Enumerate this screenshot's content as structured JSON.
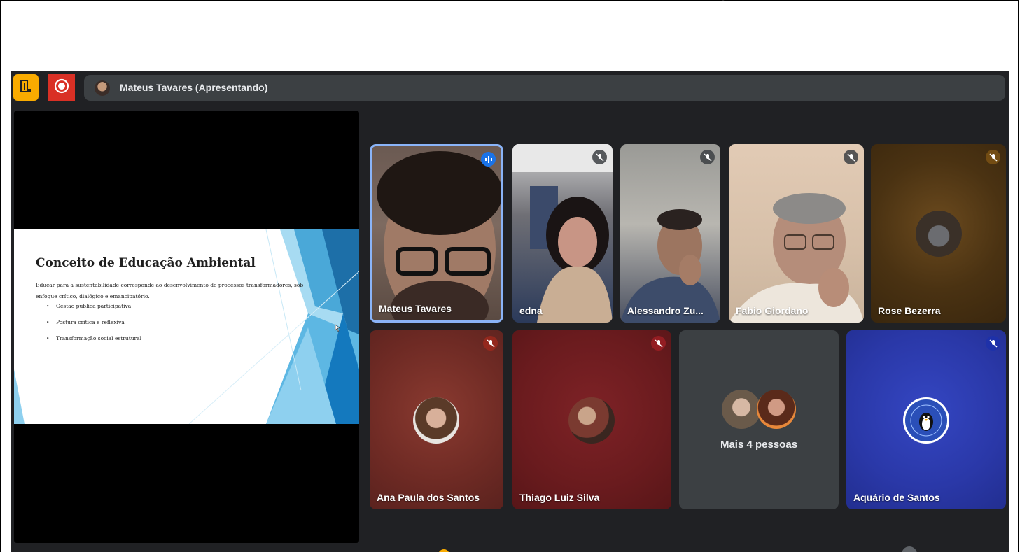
{
  "header": {
    "presenter_label": "Mateus Tavares (Apresentando)"
  },
  "slide": {
    "title": "Conceito de Educação Ambiental",
    "body": "Educar para a sustentabilidade corresponde ao desenvolvimento de processos transformadores, sob enfoque crítico, dialógico e emancipatório.",
    "bullets": [
      "Gestão pública participativa",
      "Postura crítica e reflexiva",
      "Transformação social estrutural"
    ],
    "bullet_marker": "•"
  },
  "participants": [
    {
      "name": "Mateus Tavares",
      "status": "speaking"
    },
    {
      "name": "edna",
      "status": "muted"
    },
    {
      "name": "Alessandro Zu...",
      "status": "muted"
    },
    {
      "name": "Fabio Giordano",
      "status": "muted"
    },
    {
      "name": "Rose Bezerra",
      "status": "muted"
    },
    {
      "name": "Ana Paula dos Santos",
      "status": "muted"
    },
    {
      "name": "Thiago Luiz Silva",
      "status": "muted"
    },
    {
      "name": "Aquário de Santos",
      "status": "muted"
    }
  ],
  "more_people": {
    "label": "Mais 4 pessoas"
  },
  "icons": {
    "exit": "door-exit-icon",
    "record": "record-icon",
    "speaking": "audio-level-icon",
    "muted": "mic-off-icon"
  },
  "colors": {
    "background": "#202124",
    "exit_button": "#f9ab00",
    "record_button": "#d93025",
    "active_speaker_border": "#8ab4f8",
    "tile_maroon": "#7a2a24",
    "tile_red": "#6e1a1c",
    "tile_blue": "#2838a8",
    "tile_gray": "#3c4043"
  }
}
